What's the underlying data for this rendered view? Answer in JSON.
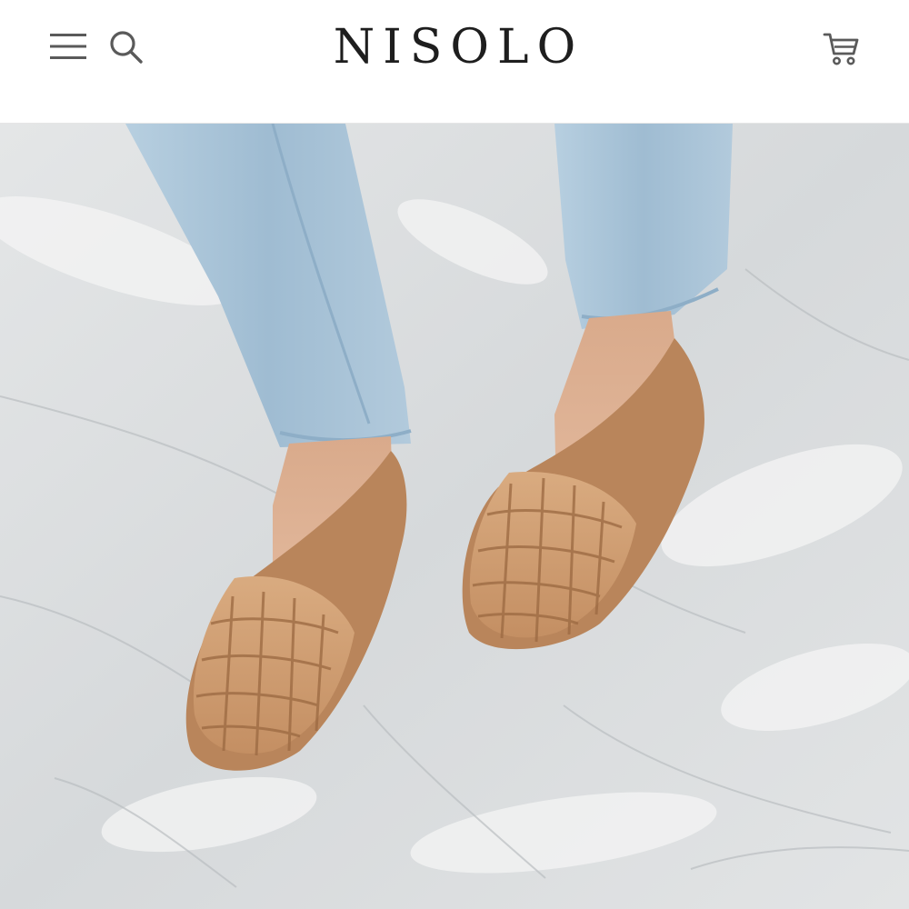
{
  "header": {
    "brand": "NISOLO",
    "icons": {
      "menu": "hamburger-menu-icon",
      "search": "search-icon",
      "cart": "shopping-cart-icon"
    }
  },
  "colors": {
    "header_bg": "#ffffff",
    "icon_gray": "#5a5a5a",
    "brand_text": "#1e1e1e",
    "stone": "#d9dcdd",
    "denim": "#a9c3d6",
    "leather": "#cf9e73"
  },
  "hero": {
    "image": "product-lifestyle-photo-woven-leather-flats"
  }
}
